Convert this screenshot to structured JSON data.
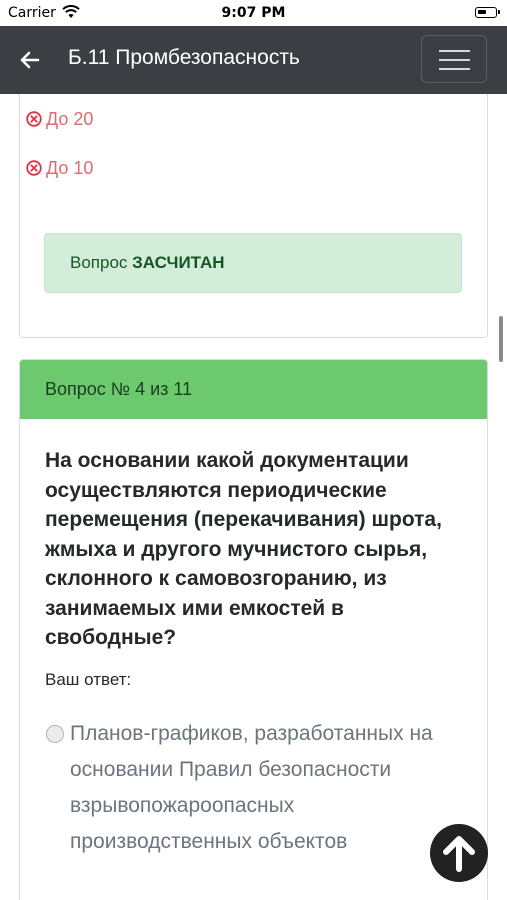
{
  "status_bar": {
    "carrier": "Carrier",
    "time": "9:07 PM"
  },
  "navbar": {
    "title": "Б.11 Промбезопасность",
    "back_icon": "arrow-left-icon",
    "menu_icon": "hamburger-icon"
  },
  "previous_question": {
    "options": [
      {
        "label": "До 20",
        "state": "wrong"
      },
      {
        "label": "До 10",
        "state": "wrong"
      }
    ],
    "result": {
      "prefix": "Вопрос",
      "status": "ЗАСЧИТАН"
    }
  },
  "current_question": {
    "header": "Вопрос № 4 из 11",
    "text": "На основании какой документации осуществляются периодические перемещения (перекачивания) шрота, жмыха и другого мучнистого сырья, склонного к самовозгоранию, из занимаемых ими емкостей в свободные?",
    "answer_label": "Ваш ответ:",
    "options": [
      {
        "label": "Планов-графиков, разработанных на основании Правил безопасности взрывопожароопасных производственных объектов",
        "selected": false
      }
    ]
  },
  "colors": {
    "navbar_bg": "#3b3f44",
    "header_green": "#6cc96e",
    "success_bg": "#d4edda",
    "wrong_red": "#e06b72"
  }
}
